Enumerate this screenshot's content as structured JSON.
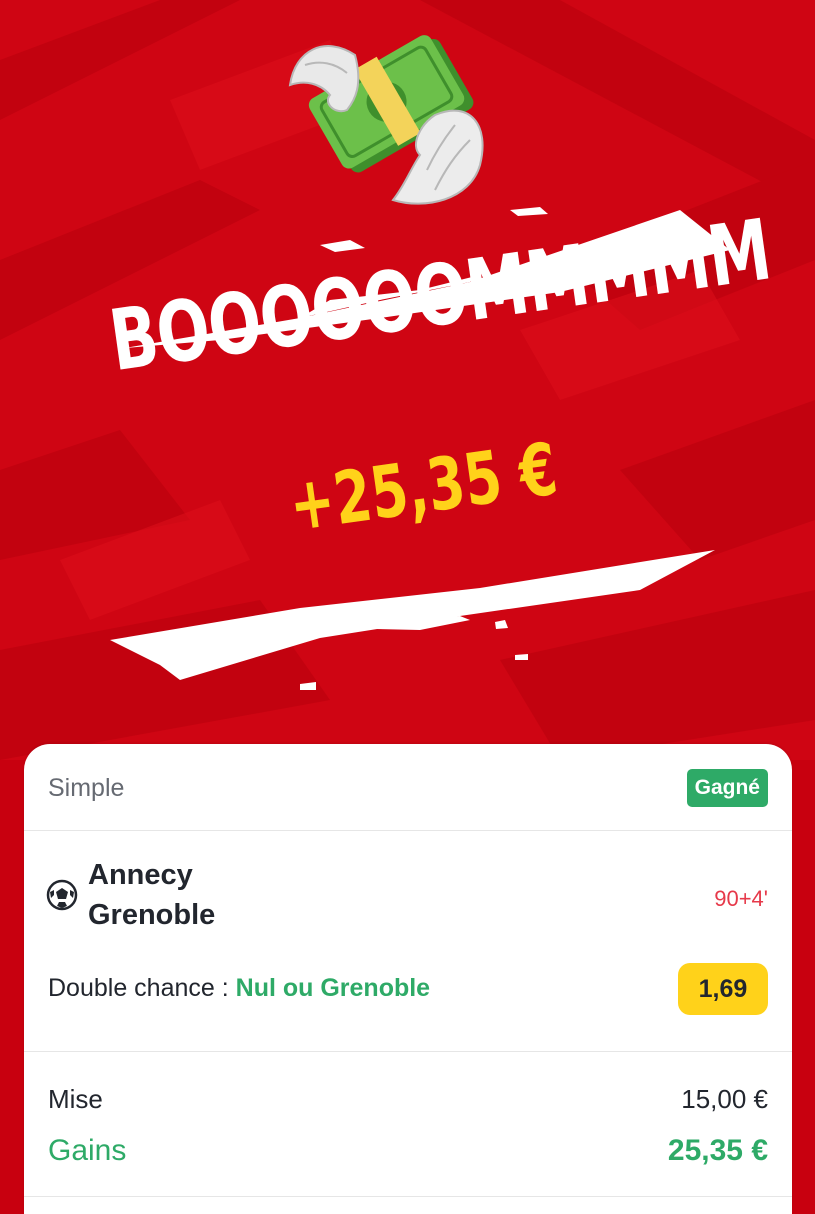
{
  "hero": {
    "headline": "BOOOOOOMMMMM",
    "amount": "+25,35 €",
    "icon": "money-with-wings-icon"
  },
  "bet": {
    "type": "Simple",
    "status": "Gagné",
    "sport_icon": "soccer-ball-icon",
    "home_team": "Annecy",
    "away_team": "Grenoble",
    "match_time": "90+4'",
    "market_label": "Double chance :",
    "market_choice": "Nul ou Grenoble",
    "odds": "1,69",
    "stake_label": "Mise",
    "stake_value": "15,00 €",
    "winnings_label": "Gains",
    "winnings_value": "25,35 €"
  },
  "colors": {
    "hero_red": "#cf0513",
    "win_green": "#2eaa67",
    "odds_yellow": "#ffd21a",
    "live_red": "#e6394a"
  }
}
